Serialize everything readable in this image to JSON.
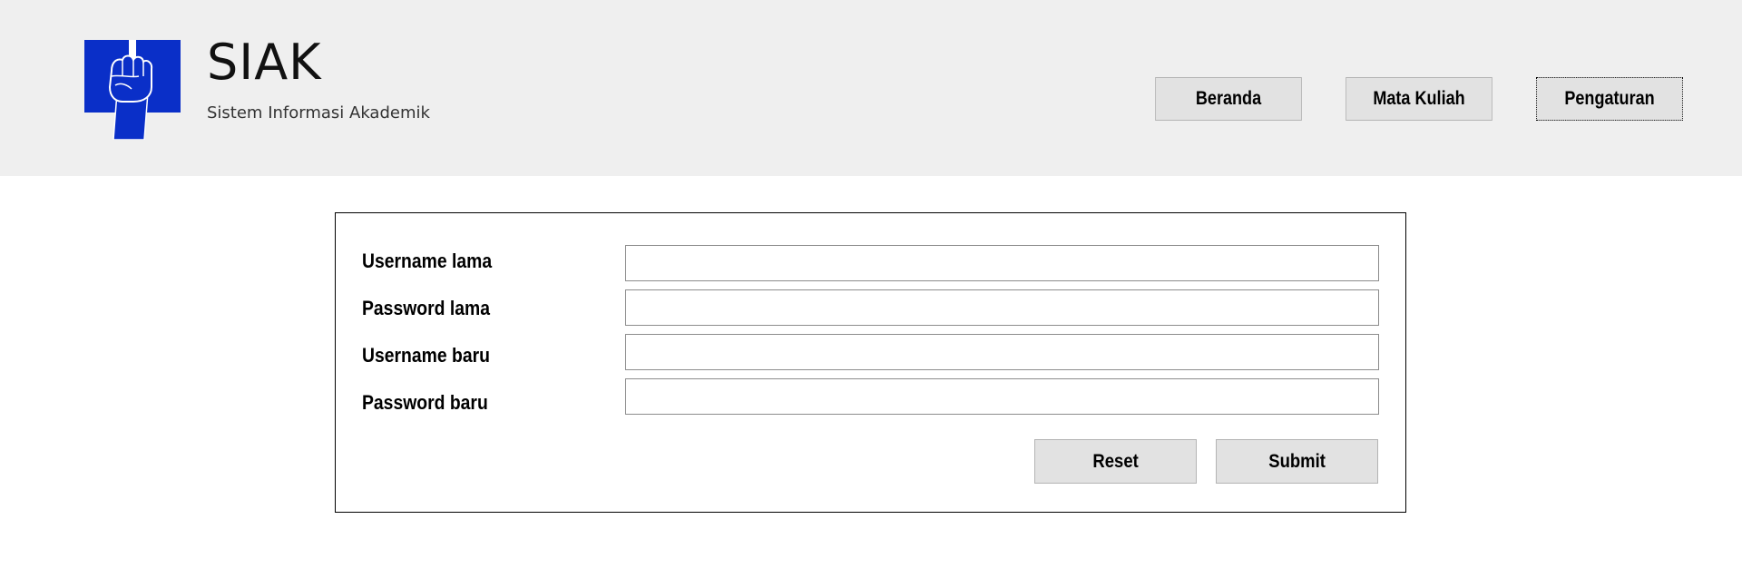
{
  "header": {
    "brand_title": "SIAK",
    "brand_subtitle": "Sistem Informasi Akademik",
    "logo_icon": "fist-book-logo-icon",
    "logo_color": "#0a2fc8",
    "background": "#efefef"
  },
  "nav": {
    "items": [
      {
        "label": "Beranda",
        "active": false
      },
      {
        "label": "Mata Kuliah",
        "active": false
      },
      {
        "label": "Pengaturan",
        "active": true
      }
    ]
  },
  "form": {
    "fields": [
      {
        "label": "Username lama",
        "value": "",
        "placeholder": ""
      },
      {
        "label": "Password lama",
        "value": "",
        "placeholder": ""
      },
      {
        "label": "Username baru",
        "value": "",
        "placeholder": ""
      },
      {
        "label": "Password baru",
        "value": "",
        "placeholder": ""
      }
    ],
    "reset_label": "Reset",
    "submit_label": "Submit"
  }
}
